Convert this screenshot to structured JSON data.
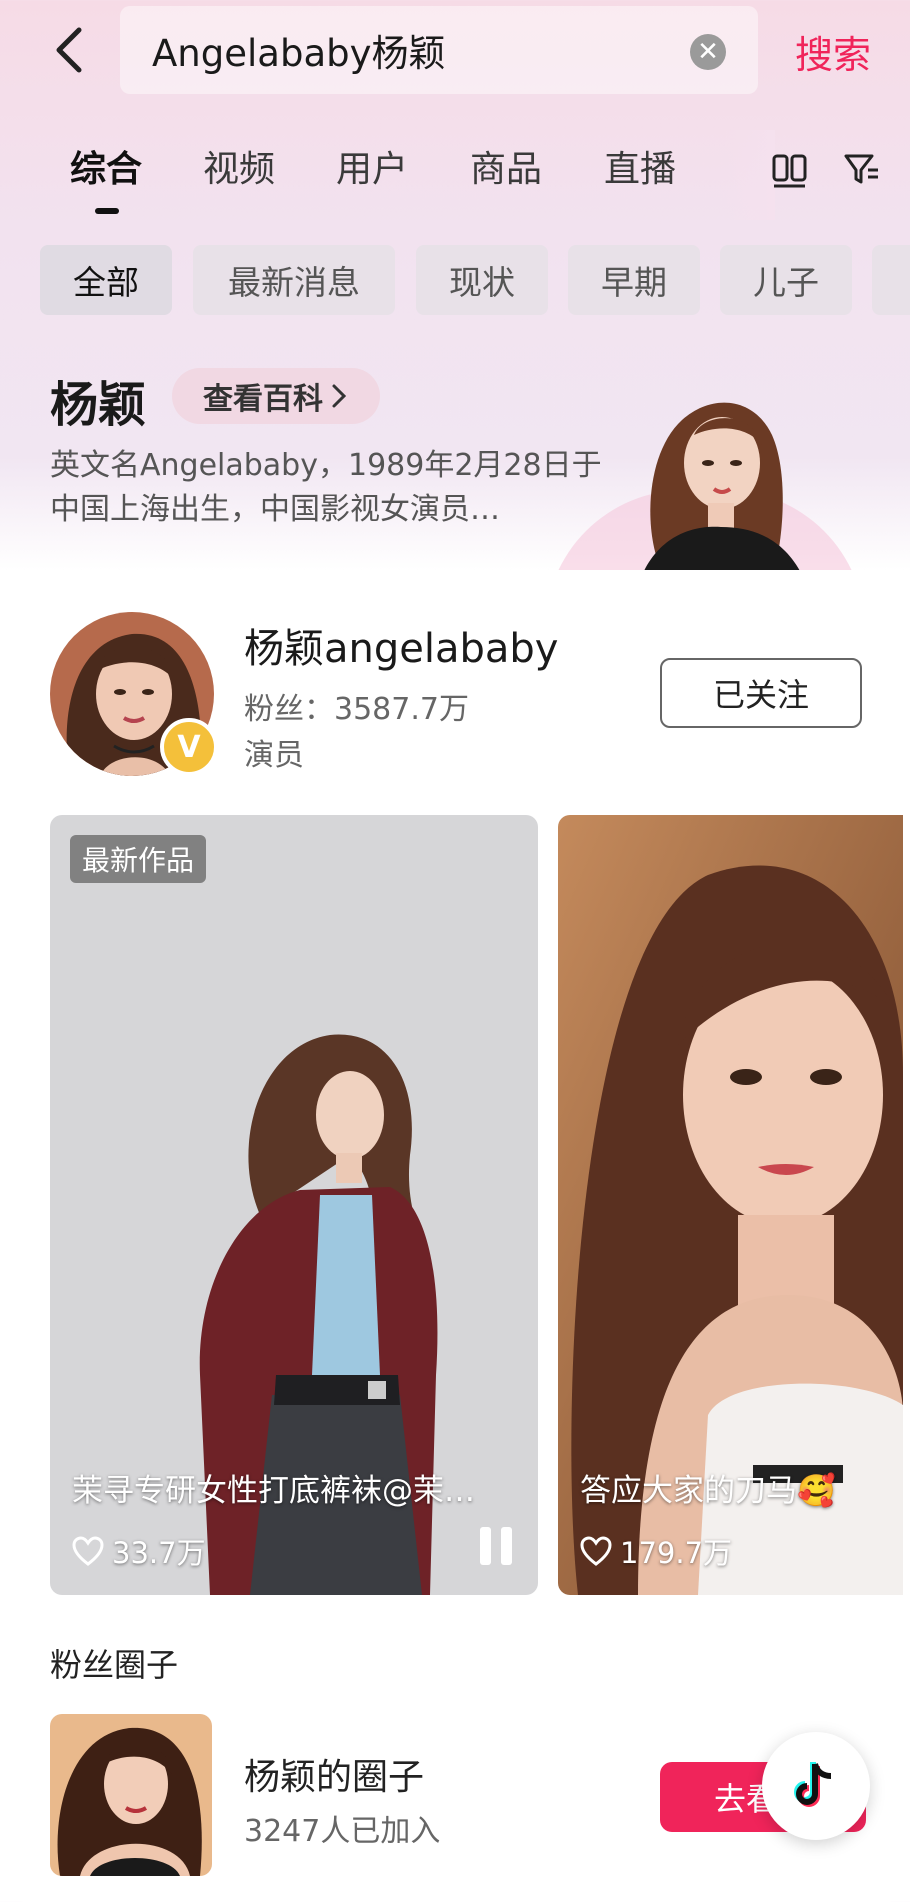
{
  "search": {
    "query": "Angelababy杨颖",
    "action_label": "搜索"
  },
  "tabs": [
    {
      "label": "综合",
      "active": true
    },
    {
      "label": "视频"
    },
    {
      "label": "用户"
    },
    {
      "label": "商品"
    },
    {
      "label": "直播"
    }
  ],
  "chips": [
    {
      "label": "全部",
      "active": true
    },
    {
      "label": "最新消息"
    },
    {
      "label": "现状"
    },
    {
      "label": "早期"
    },
    {
      "label": "儿子"
    }
  ],
  "baike": {
    "name": "杨颖",
    "button_label": "查看百科",
    "description": "英文名Angelababy，1989年2月28日于中国上海出生，中国影视女演员…"
  },
  "user": {
    "name": "杨颖angelababy",
    "fans": "粉丝：3587.7万",
    "role": "演员",
    "follow_label": "已关注",
    "verified_badge": "V"
  },
  "videos": [
    {
      "tag": "最新作品",
      "title": "茉寻专研女性打底裤袜@茉…",
      "likes": "33.7万"
    },
    {
      "title": "答应大家的刀马🥰",
      "likes": "179.7万"
    }
  ],
  "fans_circle": {
    "section_title": "粉丝圈子",
    "name": "杨颖的圈子",
    "count": "3247人已加入",
    "button_label": "去看"
  },
  "colors": {
    "accent": "#f0245a",
    "badge": "#f4c03a"
  },
  "icons": [
    "back-arrow-icon",
    "clear-icon",
    "grid-view-icon",
    "filter-icon",
    "chevron-right-icon",
    "heart-icon",
    "pause-icon",
    "tiktok-logo-icon"
  ]
}
